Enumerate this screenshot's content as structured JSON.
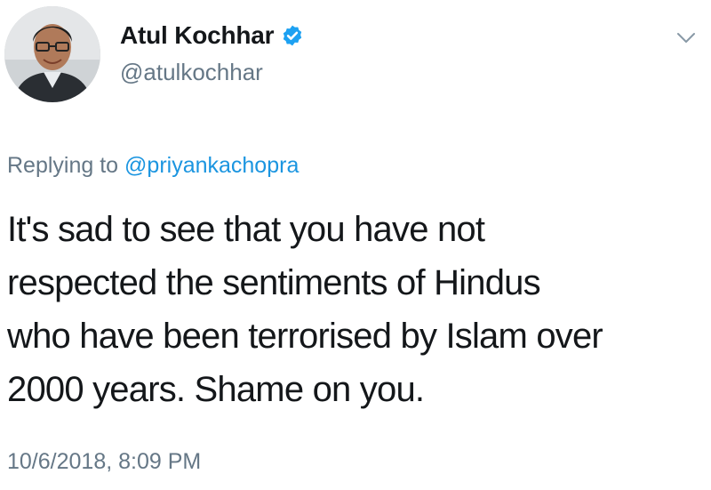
{
  "tweet": {
    "author": {
      "display_name": "Atul Kochhar",
      "handle": "@atulkochhar",
      "verified_icon": "verified-badge-icon",
      "avatar": "profile-photo"
    },
    "menu_icon": "chevron-down-icon",
    "reply_prefix": "Replying to",
    "reply_mention": "@priyankachopra",
    "text_lines": [
      "It's sad to see that you have not",
      "respected the sentiments of Hindus",
      "who have been terrorised by Islam over",
      "2000 years. Shame on you."
    ],
    "timestamp": "10/6/2018, 8:09 PM"
  },
  "colors": {
    "text": "#14171a",
    "secondary": "#657786",
    "link": "#1b95e0",
    "verified": "#1da1f2",
    "background": "#ffffff"
  }
}
